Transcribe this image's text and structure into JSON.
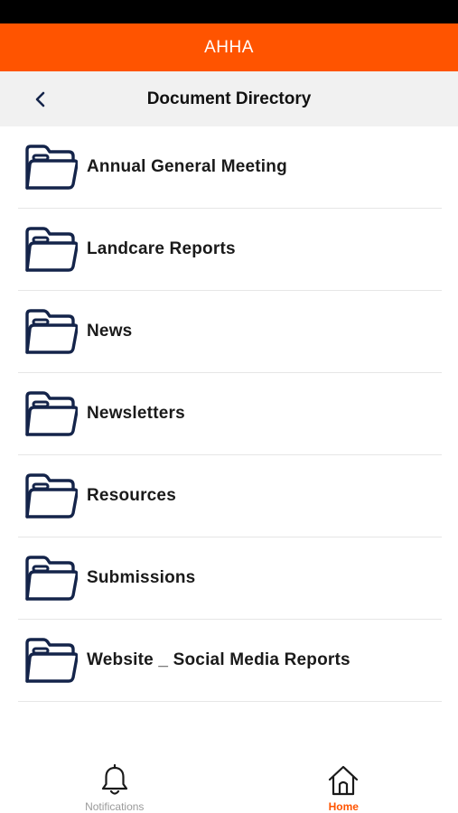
{
  "app": {
    "title": "AHHA",
    "brand_color": "#ff5400"
  },
  "nav": {
    "title": "Document Directory",
    "back_icon": "chevron-left-icon"
  },
  "directory": {
    "folder_icon": "folder-icon",
    "icon_color": "#14244a",
    "items": [
      {
        "label": "Annual General Meeting"
      },
      {
        "label": "Landcare Reports"
      },
      {
        "label": "News"
      },
      {
        "label": "Newsletters"
      },
      {
        "label": "Resources"
      },
      {
        "label": "Submissions"
      },
      {
        "label": "Website _ Social Media Reports"
      }
    ]
  },
  "tabs": [
    {
      "label": "Notifications",
      "icon": "bell-icon",
      "active": false,
      "color": "#9a9a9a"
    },
    {
      "label": "Home",
      "icon": "home-icon",
      "active": true,
      "color": "#ff5400"
    }
  ]
}
